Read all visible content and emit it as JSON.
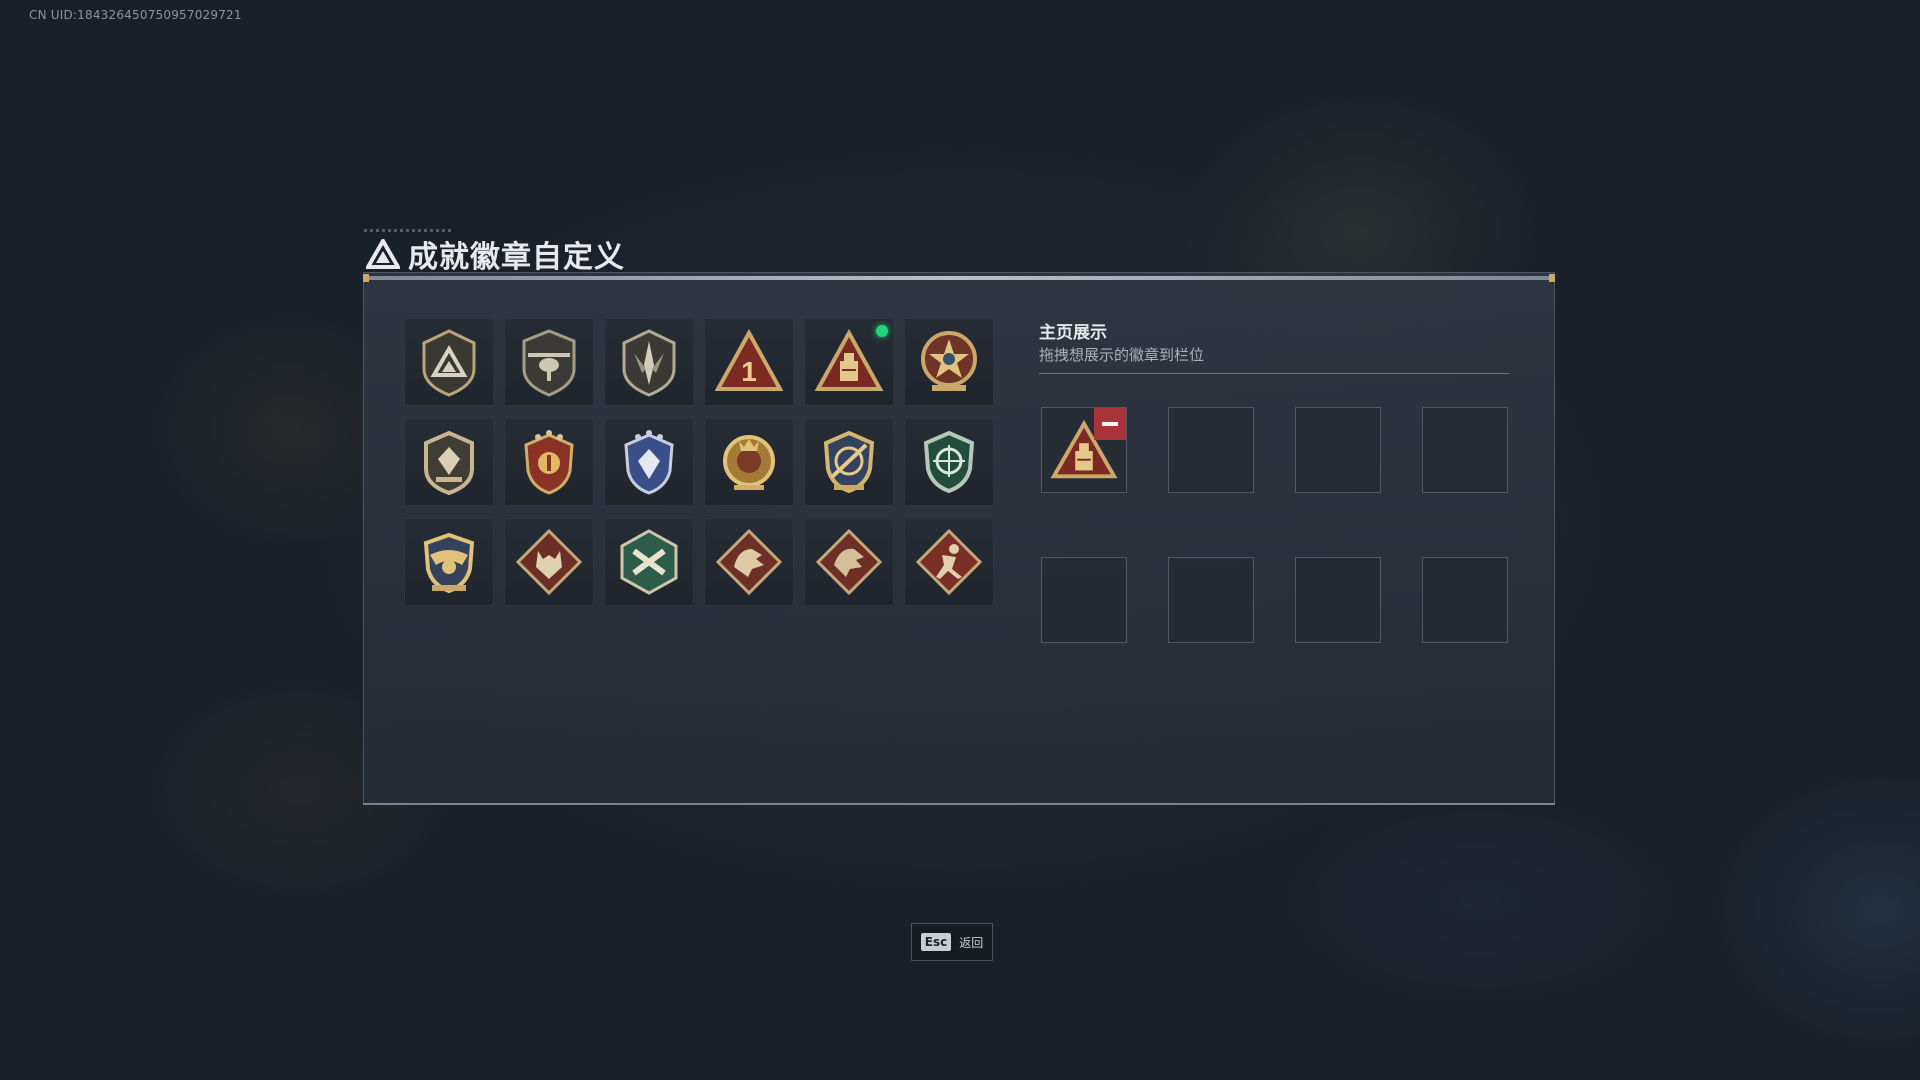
{
  "uid_text": "CN UID:184326450750957029721",
  "title": "成就徽章自定义",
  "showcase": {
    "title": "主页展示",
    "subtitle": "拖拽想展示的徽章到栏位"
  },
  "badges": [
    {
      "icon": "triangle-shield-badge"
    },
    {
      "icon": "helicopter-shield-badge"
    },
    {
      "icon": "blade-shield-badge"
    },
    {
      "icon": "red-triangle-number-one-badge"
    },
    {
      "icon": "red-triangle-tower-badge",
      "new": true
    },
    {
      "icon": "star-wreath-badge"
    },
    {
      "icon": "winged-shield-badge"
    },
    {
      "icon": "red-crest-badge"
    },
    {
      "icon": "blue-crest-badge"
    },
    {
      "icon": "gold-crown-crest-badge"
    },
    {
      "icon": "crosshair-gold-crest-badge"
    },
    {
      "icon": "green-crosshair-badge"
    },
    {
      "icon": "gold-eagle-crest-badge"
    },
    {
      "icon": "wolf-diamond-badge"
    },
    {
      "icon": "green-weapon-hex-badge"
    },
    {
      "icon": "dragon-diamond-badge"
    },
    {
      "icon": "dragon-diamond-badge-alt"
    },
    {
      "icon": "runner-diamond-badge"
    }
  ],
  "slots": [
    {
      "icon": "red-triangle-tower-badge",
      "filled": true
    },
    {
      "filled": false
    },
    {
      "filled": false
    },
    {
      "filled": false
    },
    {
      "filled": false
    },
    {
      "filled": false
    },
    {
      "filled": false
    },
    {
      "filled": false
    }
  ],
  "footer": {
    "key": "Esc",
    "label": "返回"
  },
  "colors": {
    "new_dot": "#1fd47a",
    "remove_button": "#a8343a",
    "accent_gold": "#c9a86a"
  }
}
